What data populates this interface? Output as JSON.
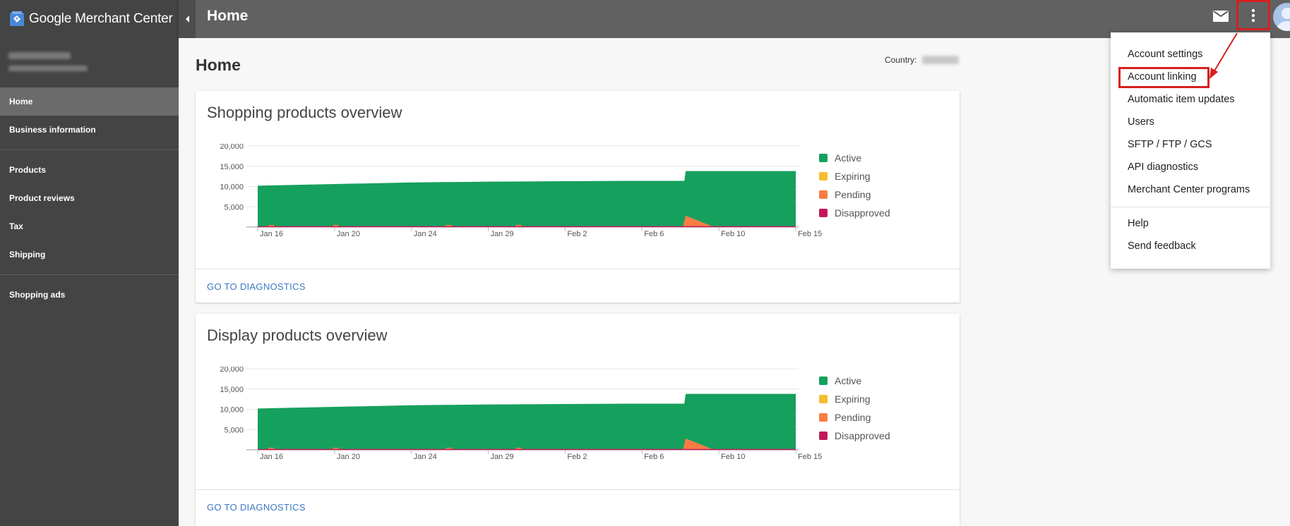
{
  "brand": {
    "name": "Google Merchant Center",
    "accent": "#4a86d8"
  },
  "sidebar": {
    "items": [
      {
        "label": "Home",
        "active": true
      },
      {
        "label": "Business information"
      },
      {
        "label": "Products"
      },
      {
        "label": "Product reviews"
      },
      {
        "label": "Tax"
      },
      {
        "label": "Shipping"
      },
      {
        "label": "Shopping ads"
      }
    ]
  },
  "topbar": {
    "title": "Home",
    "mail_icon": "mail-icon",
    "more_icon": "more-vert-icon"
  },
  "page": {
    "title": "Home",
    "country_label": "Country:"
  },
  "cards": [
    {
      "title": "Shopping products overview",
      "link": "GO TO DIAGNOSTICS",
      "chart_data": {
        "type": "area",
        "yticks": [
          "20,000",
          "15,000",
          "10,000",
          "5,000"
        ],
        "ylim": [
          0,
          20000
        ],
        "x": [
          "Jan 16",
          "Jan 20",
          "Jan 24",
          "Jan 29",
          "Feb 2",
          "Feb 6",
          "Feb 10",
          "Feb 15"
        ],
        "series": [
          {
            "name": "Active",
            "color": "#16a05d",
            "values": [
              10200,
              10600,
              11000,
              11200,
              11300,
              11400,
              13800,
              13800
            ]
          },
          {
            "name": "Expiring",
            "color": "#f6be2d",
            "values": [
              0,
              0,
              0,
              0,
              0,
              0,
              0,
              0
            ]
          },
          {
            "name": "Pending",
            "color": "#fa7c44",
            "values": [
              200,
              300,
              0,
              0,
              0,
              0,
              2800,
              0
            ]
          },
          {
            "name": "Disapproved",
            "color": "#c2185b",
            "values": [
              100,
              100,
              100,
              100,
              100,
              100,
              100,
              100
            ]
          }
        ]
      }
    },
    {
      "title": "Display products overview",
      "link": "GO TO DIAGNOSTICS",
      "chart_data": {
        "type": "area",
        "yticks": [
          "20,000",
          "15,000",
          "10,000",
          "5,000"
        ],
        "ylim": [
          0,
          20000
        ],
        "x": [
          "Jan 16",
          "Jan 20",
          "Jan 24",
          "Jan 29",
          "Feb 2",
          "Feb 6",
          "Feb 10",
          "Feb 15"
        ],
        "series": [
          {
            "name": "Active",
            "color": "#16a05d",
            "values": [
              10200,
              10600,
              11000,
              11200,
              11300,
              11400,
              13800,
              13800
            ]
          },
          {
            "name": "Expiring",
            "color": "#f6be2d",
            "values": [
              0,
              0,
              0,
              0,
              0,
              0,
              0,
              0
            ]
          },
          {
            "name": "Pending",
            "color": "#fa7c44",
            "values": [
              200,
              300,
              0,
              0,
              0,
              0,
              2800,
              0
            ]
          },
          {
            "name": "Disapproved",
            "color": "#c2185b",
            "values": [
              100,
              100,
              100,
              100,
              100,
              100,
              100,
              100
            ]
          }
        ]
      }
    }
  ],
  "menu": {
    "items": [
      "Account settings",
      "Account linking",
      "Automatic item updates",
      "Users",
      "SFTP / FTP / GCS",
      "API diagnostics",
      "Merchant Center programs"
    ],
    "secondary": [
      "Help",
      "Send feedback"
    ],
    "highlighted": "Account linking",
    "highlight_color": "#d61f1f"
  }
}
